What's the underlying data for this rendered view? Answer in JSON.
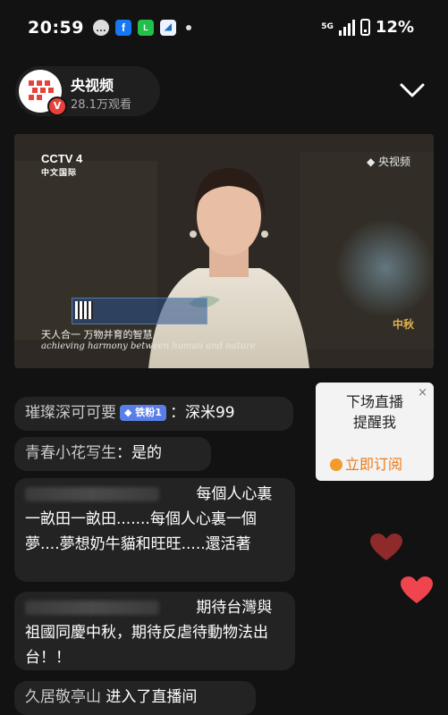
{
  "status_bar": {
    "time": "20:59",
    "network": "5G",
    "battery": "12%",
    "notification_icons": [
      "chat-bubble-icon",
      "facebook-icon",
      "line-icon",
      "app-icon"
    ]
  },
  "channel": {
    "name": "央视频",
    "views": "28.1万观看",
    "brand_color": "#e8413a"
  },
  "video": {
    "channel_logo": "CCTV 4",
    "channel_sub": "中文国际",
    "watermark": "央视频",
    "subtitle_cn": "天人合一  万物并育的智慧",
    "subtitle_en": "achieving harmony between human and nature",
    "corner_text": "中秋"
  },
  "chat": [
    {
      "user": "璀璨深可可要",
      "badge": "铁粉1",
      "text": "深米99"
    },
    {
      "user": "青春小花写生",
      "text": "是的"
    },
    {
      "user_hidden": true,
      "text": "每個人心裏一畝田一畝田.......每個人心裏一個夢....夢想奶牛貓和旺旺.....還活著"
    },
    {
      "user_hidden": true,
      "text": "期待台灣與祖國同慶中秋，期待反虐待動物法出台！！"
    },
    {
      "user": "久居敬亭山",
      "text": "进入了直播间"
    }
  ],
  "reminder": {
    "text_line1": "下场直播",
    "text_line2": "提醒我",
    "button": "立即订阅",
    "close": "×",
    "accent_color": "#ea7a18"
  },
  "colors": {
    "background": "#121212",
    "bubble": "#232323",
    "heart_dark": "#8e2a2a",
    "heart_bright": "#f0454f"
  }
}
